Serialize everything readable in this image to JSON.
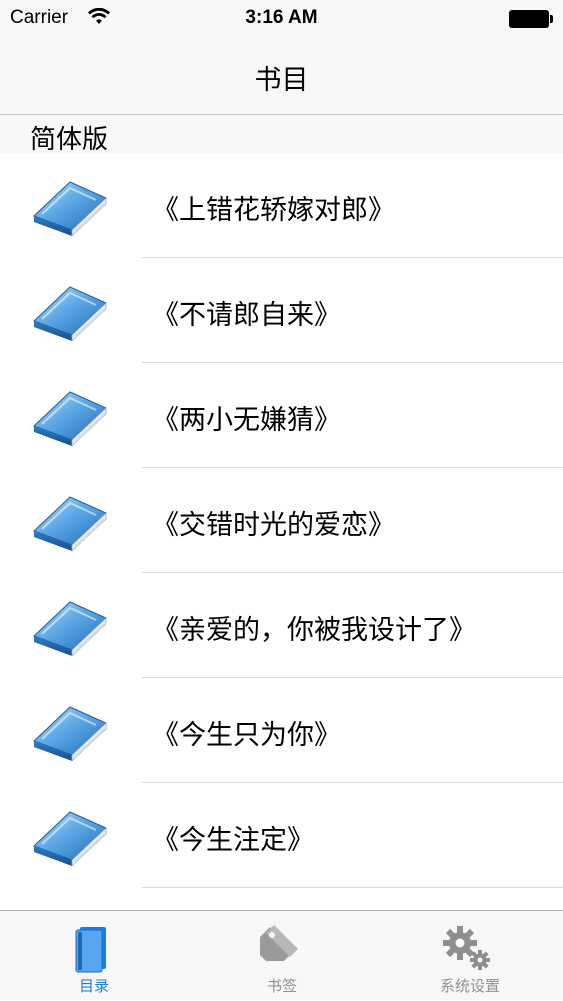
{
  "status_bar": {
    "carrier": "Carrier",
    "time": "3:16 AM"
  },
  "nav": {
    "title": "书目"
  },
  "section": {
    "header": "简体版"
  },
  "books": [
    {
      "title": "《上错花轿嫁对郎》"
    },
    {
      "title": "《不请郎自来》"
    },
    {
      "title": "《两小无嫌猜》"
    },
    {
      "title": "《交错时光的爱恋》"
    },
    {
      "title": "《亲爱的，你被我设计了》"
    },
    {
      "title": "《今生只为你》"
    },
    {
      "title": "《今生注定》"
    }
  ],
  "tab_bar": {
    "tabs": [
      {
        "label": "目录",
        "icon": "book-icon",
        "active": true
      },
      {
        "label": "书签",
        "icon": "tag-icon",
        "active": false
      },
      {
        "label": "系统设置",
        "icon": "gears-icon",
        "active": false
      }
    ]
  },
  "colors": {
    "accent": "#1a7fe6",
    "inactive_tab": "#929292",
    "bar_background": "#f7f7f7"
  }
}
